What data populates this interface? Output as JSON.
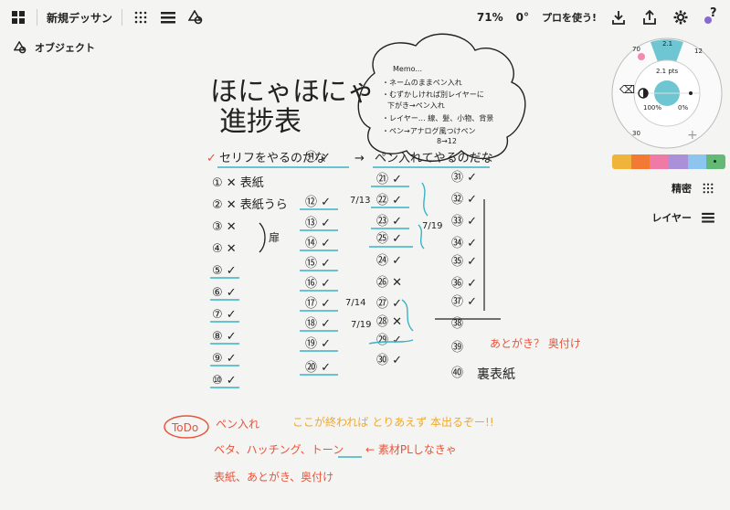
{
  "toolbar": {
    "title": "新規デッサン",
    "zoom": "71%",
    "rotation": "0°",
    "pro_label": "プロを使う!",
    "help": "?"
  },
  "object_label": "オブジェクト",
  "brush": {
    "size_top": "2.1",
    "size_label": "2.1 pts",
    "opacity": "100%",
    "smoothing": "0%",
    "marks": [
      "70",
      "12",
      "30"
    ]
  },
  "palette": {
    "colors": [
      "#f0b43a",
      "#f27a35",
      "#ef7aa6",
      "#a990d8",
      "#8ec5ef",
      "#62ba76"
    ]
  },
  "side": {
    "precision_label": "精密",
    "layers_label": "レイヤー"
  },
  "note": {
    "title1": "ほにゃほにゃ",
    "title2": "進捗表",
    "memo_lines": [
      "Memo...",
      "・ネームのままペン入れ",
      "・むずかしければ別レイヤーに",
      "下がき→ペン入れ",
      "・レイヤー… 線、髪、小物、背景",
      "・ペン→アナログ風つけペン",
      "8→12"
    ],
    "headline_a": "セリフをやるのだな",
    "headline_b": "ペン入れてやるのだな",
    "col1": [
      "① ✕ 表紙",
      "② ✕ 表紙うら",
      "③ ✕",
      "④ ✕",
      "⑤ ✓",
      "⑥ ✓",
      "⑦ ✓",
      "⑧ ✓",
      "⑨ ✓",
      "⑩ ✓"
    ],
    "tobira": "扉",
    "col2": [
      "⑪ ✓",
      "⑫ ✓",
      "⑬ ✓",
      "⑭ ✓",
      "⑮ ✓",
      "⑯ ✓",
      "⑰ ✓",
      "⑱ ✓",
      "⑲ ✓",
      "⑳ ✓"
    ],
    "col3": [
      "㉑ ✓",
      "㉒ ✓",
      "㉓ ✓",
      "㉔ ✓",
      "㉕ ✓",
      "㉖ ✕",
      "㉗ ✓",
      "㉘ ✕",
      "㉙ ✓",
      "㉚ ✓"
    ],
    "col4": [
      "㉛ ✓",
      "㉜ ✓",
      "㉝ ✓",
      "㉞ ✓",
      "㉟ ✓",
      "㊱ ✓",
      "㊲ ✓",
      "㊳",
      "㊴",
      "㊵"
    ],
    "dates": [
      "7/13",
      "7/19",
      "7/14",
      "7/19"
    ],
    "atogaki": "あとがき？ 奥付け",
    "urahyoshi": "裏表紙",
    "todo_badge": "ToDo",
    "todo1": "ペン入れ",
    "todo1b": "ここが終われば とりあえず 本出るぞー!!",
    "todo2": "ベタ、ハッチング、トーン",
    "todo2b": "← 素材PLしなきゃ",
    "todo3": "表紙、あとがき、奥付け"
  }
}
